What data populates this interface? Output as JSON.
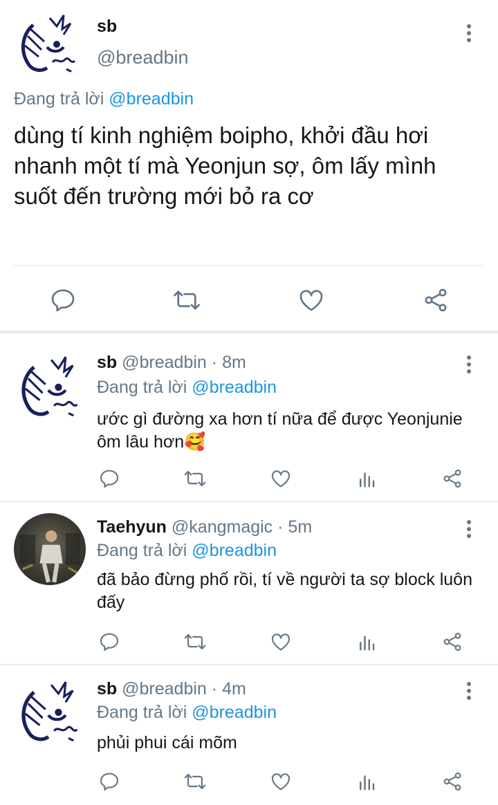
{
  "main_tweet": {
    "name": "sb",
    "handle": "@breadbin",
    "replying_prefix": "Đang trả lời",
    "replying_to": "@breadbin",
    "text": "dùng tí kinh nghiệm boipho, khởi đầu hơi nhanh một tí mà Yeonjun sợ, ôm lấy mình suốt đến trường mới bỏ ra cơ",
    "actions": [
      "reply-icon",
      "retweet-icon",
      "like-icon",
      "share-icon"
    ]
  },
  "replies": [
    {
      "name": "sb",
      "handle": "@breadbin",
      "dot": "·",
      "time": "8m",
      "replying_prefix": "Đang trả lời",
      "replying_to": "@breadbin",
      "text": "ước gì đường xa hơn tí nữa để được Yeonjunie ôm lâu hơn🥰",
      "avatar": "sketch-avatar"
    },
    {
      "name": "Taehyun",
      "handle": "@kangmagic",
      "dot": "·",
      "time": "5m",
      "replying_prefix": "Đang trả lời",
      "replying_to": "@breadbin",
      "text": "đã bảo đừng phố rồi, tí về người ta sợ block luôn đấy",
      "avatar": "photo-avatar"
    },
    {
      "name": "sb",
      "handle": "@breadbin",
      "dot": "·",
      "time": "4m",
      "replying_prefix": "Đang trả lời",
      "replying_to": "@breadbin",
      "text": "phủi phui cái mõm",
      "avatar": "sketch-avatar"
    }
  ],
  "reply_actions": [
    "reply-icon",
    "retweet-icon",
    "like-icon",
    "analytics-icon",
    "share-icon"
  ],
  "colors": {
    "link": "#1b95e0",
    "secondary_text": "#657786",
    "divider": "#e6ecf0",
    "text": "#14171a"
  }
}
